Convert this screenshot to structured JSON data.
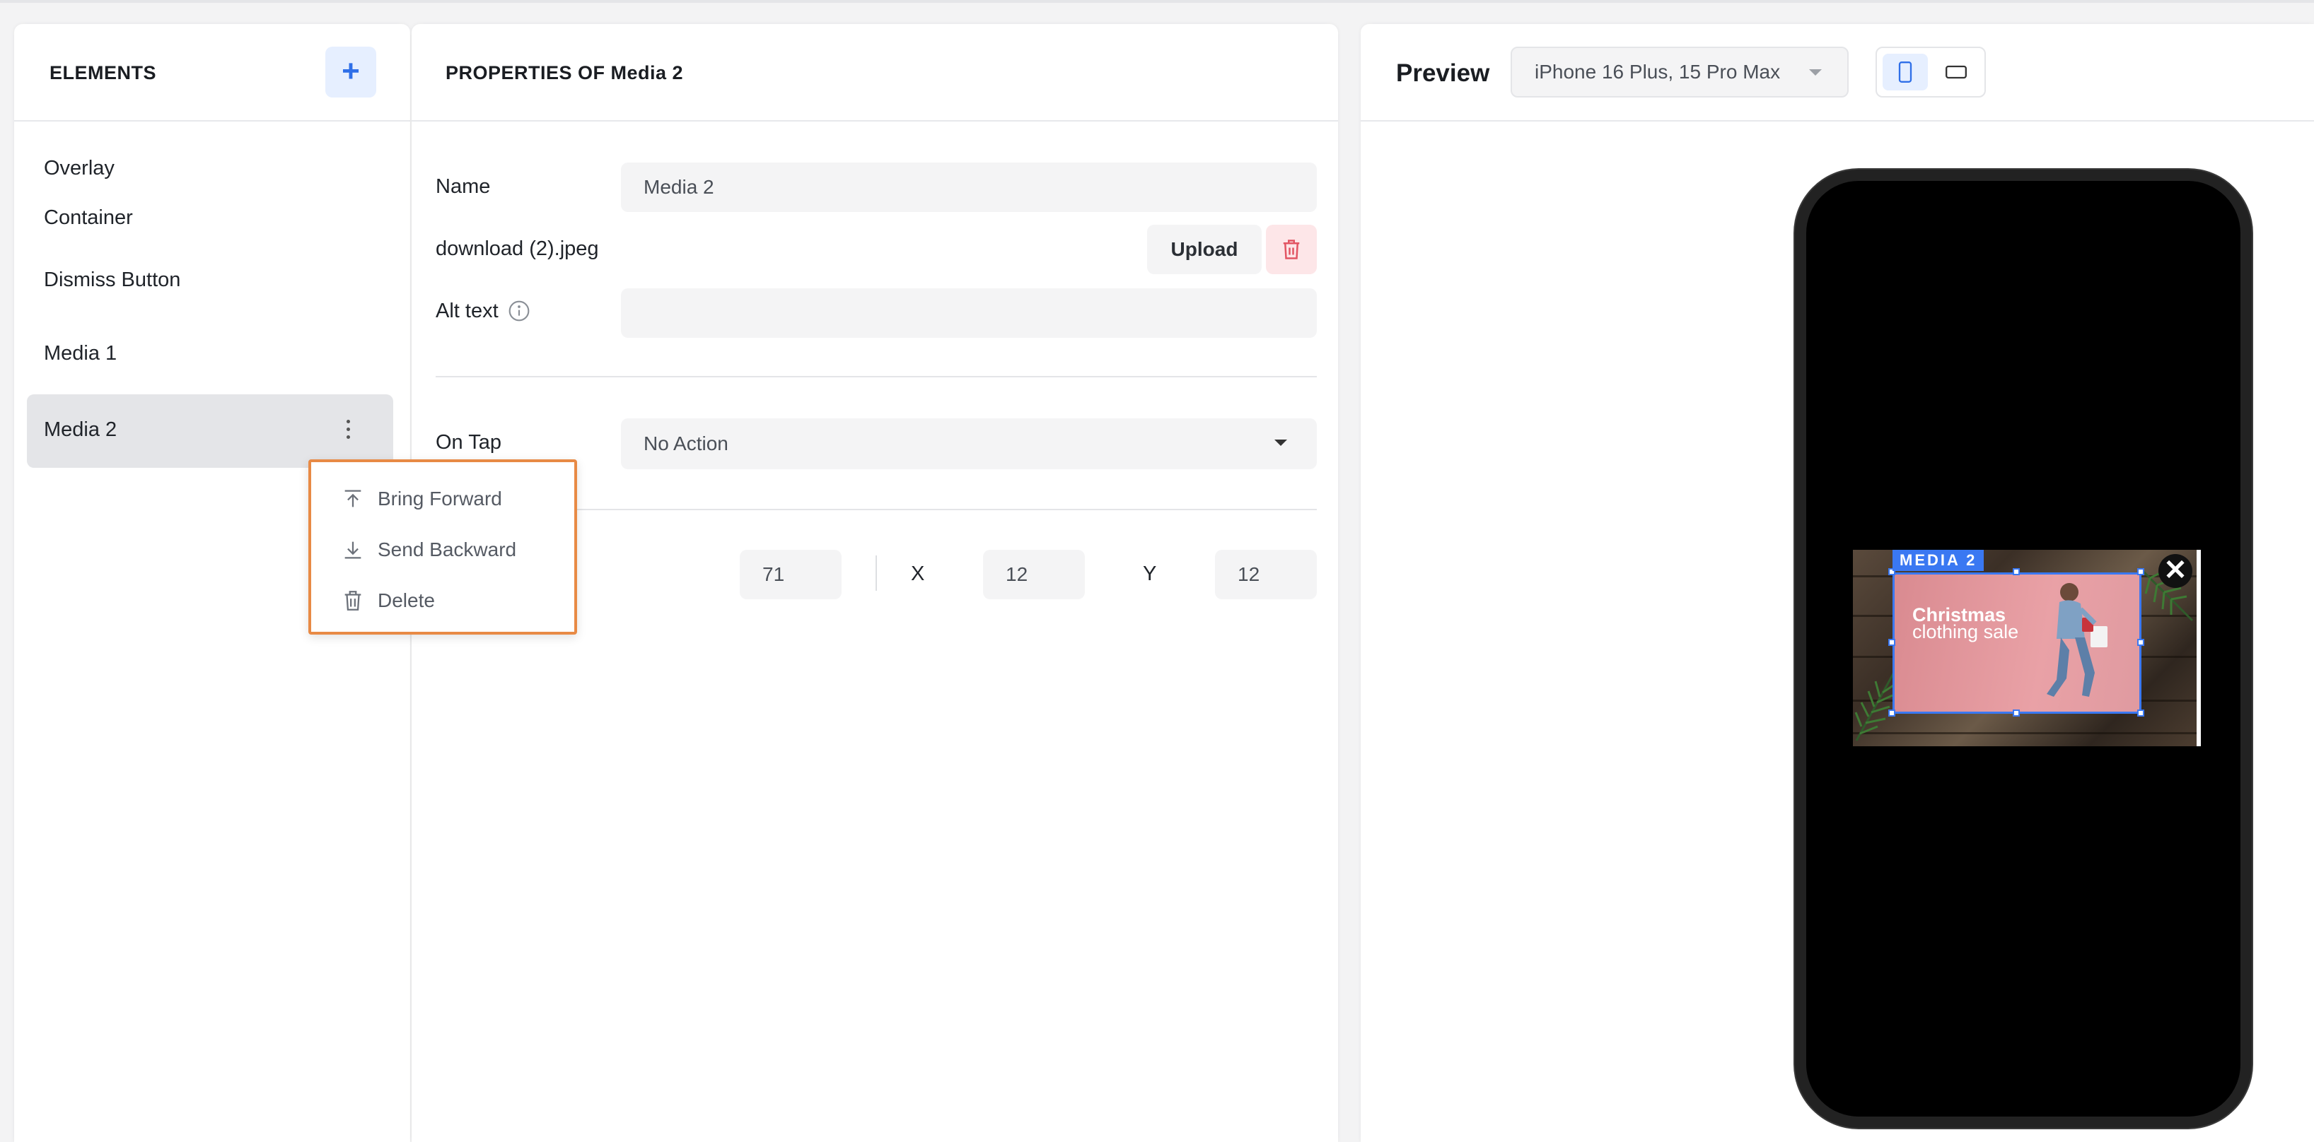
{
  "elements_panel": {
    "title": "ELEMENTS",
    "add_label": "+",
    "items": [
      {
        "label": "Overlay"
      },
      {
        "label": "Container"
      },
      {
        "label": "Dismiss Button"
      },
      {
        "label": "Media 1"
      },
      {
        "label": "Media 2",
        "selected": true
      }
    ]
  },
  "context_menu": {
    "items": [
      {
        "label": "Bring Forward",
        "icon": "bring-forward-icon"
      },
      {
        "label": "Send Backward",
        "icon": "send-backward-icon"
      },
      {
        "label": "Delete",
        "icon": "trash-icon"
      }
    ]
  },
  "properties": {
    "title": "PROPERTIES OF Media 2",
    "name_label": "Name",
    "name_value": "Media 2",
    "file_name": "download (2).jpeg",
    "upload_label": "Upload",
    "alt_text_label": "Alt text",
    "alt_text_value": "",
    "on_tap_label": "On Tap",
    "on_tap_value": "No Action",
    "size_value": "71",
    "x_label": "X",
    "x_value": "12",
    "y_label": "Y",
    "y_value": "12"
  },
  "preview": {
    "title": "Preview",
    "device": "iPhone 16 Plus, 15 Pro Max",
    "orientation": "portrait",
    "media_tag": "MEDIA 2",
    "close_symbol": "✕",
    "promo_line1": "Christmas",
    "promo_line2": "clothing sale"
  },
  "colors": {
    "accent": "#3a78f2",
    "highlight_border": "#e88a45",
    "delete_bg": "#fde6e8",
    "delete_icon": "#e25563"
  }
}
